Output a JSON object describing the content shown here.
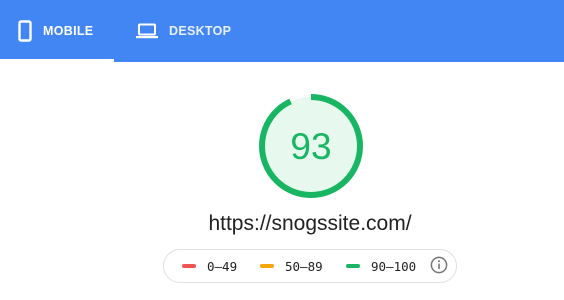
{
  "tabs": [
    {
      "label": "MOBILE",
      "icon": "phone-icon",
      "selected": true
    },
    {
      "label": "DESKTOP",
      "icon": "laptop-icon",
      "selected": false
    }
  ],
  "score": {
    "value": "93",
    "fraction": 0.93,
    "color": "#18b663",
    "track_color": "#e7f8ee"
  },
  "url": "https://snogssite.com/",
  "legend": [
    {
      "range": "0–49",
      "color": "#f0544f"
    },
    {
      "range": "50–89",
      "color": "#f4a60a"
    },
    {
      "range": "90–100",
      "color": "#18b663"
    }
  ],
  "colors": {
    "header": "#4286f4"
  }
}
